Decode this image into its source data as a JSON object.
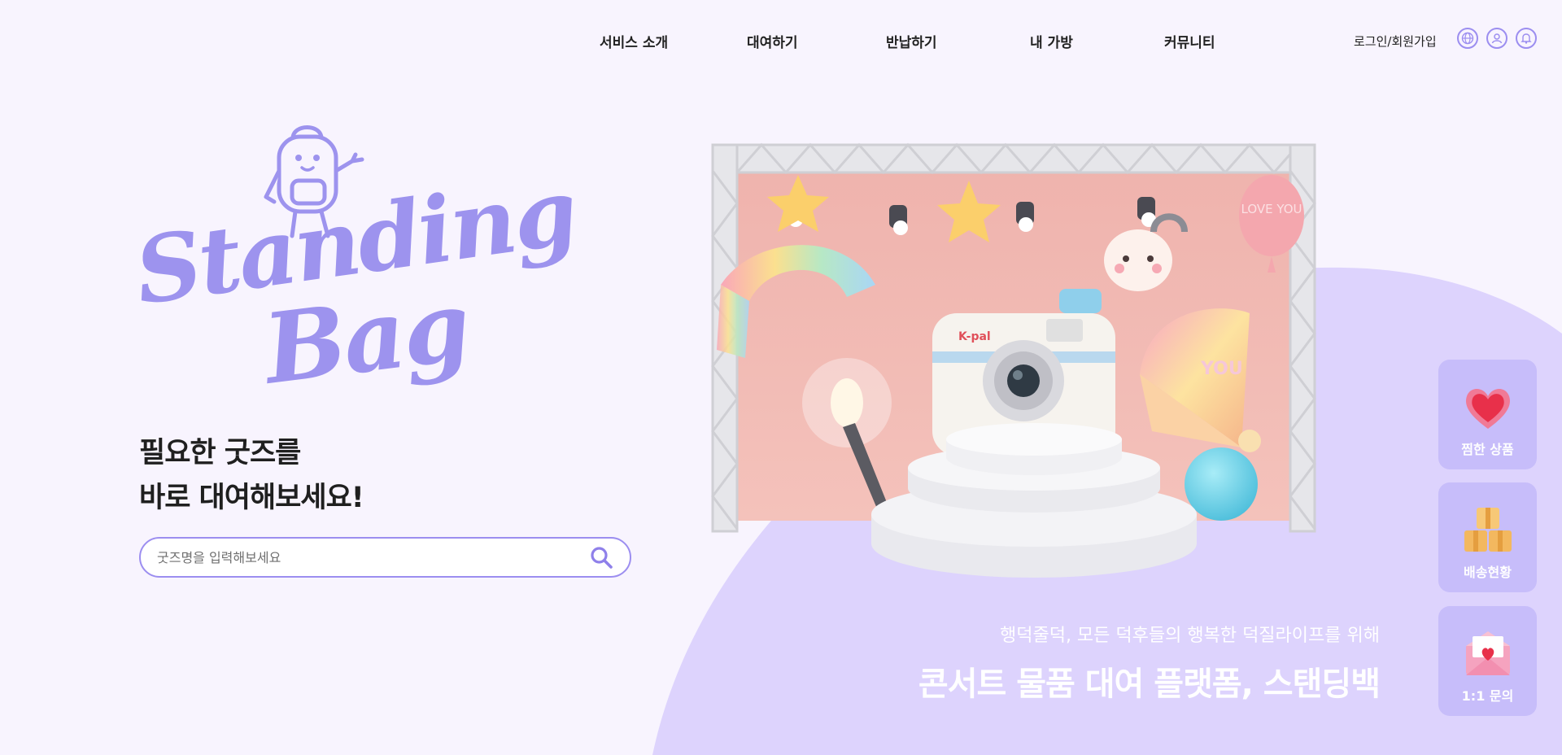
{
  "nav": {
    "items": [
      "서비스 소개",
      "대여하기",
      "반납하기",
      "내 가방",
      "커뮤니티"
    ],
    "login": "로그인/회원가입",
    "icons": [
      "globe-icon",
      "user-icon",
      "bell-icon"
    ]
  },
  "brand": {
    "logo_line1": "Standing",
    "logo_line2": "Bag",
    "color": "#9d93ee"
  },
  "hero": {
    "headline_line1": "필요한 굿즈를",
    "headline_line2": "바로 대여해보세요!",
    "search_placeholder": "굿즈명을 입력해보세요",
    "sub": "행덕줄덕, 모든 덕후들의 행복한 덕질라이프를 위해",
    "tagline": "콘서트 물품 대여 플랫폼, 스탠딩백",
    "stage_labels": {
      "camera_brand": "K-pal",
      "balloon_text": "LOVE YOU",
      "fan_text": "YOU"
    }
  },
  "quick_menu": [
    {
      "label": "찜한 상품",
      "icon": "heart-icon"
    },
    {
      "label": "배송현황",
      "icon": "box-icon"
    },
    {
      "label": "1:1 문의",
      "icon": "envelope-icon"
    }
  ],
  "colors": {
    "accent": "#9c8ef0",
    "lavender": "#ddd3fd",
    "background": "#f8f4fe",
    "quick_button": "#c7bdfa"
  }
}
